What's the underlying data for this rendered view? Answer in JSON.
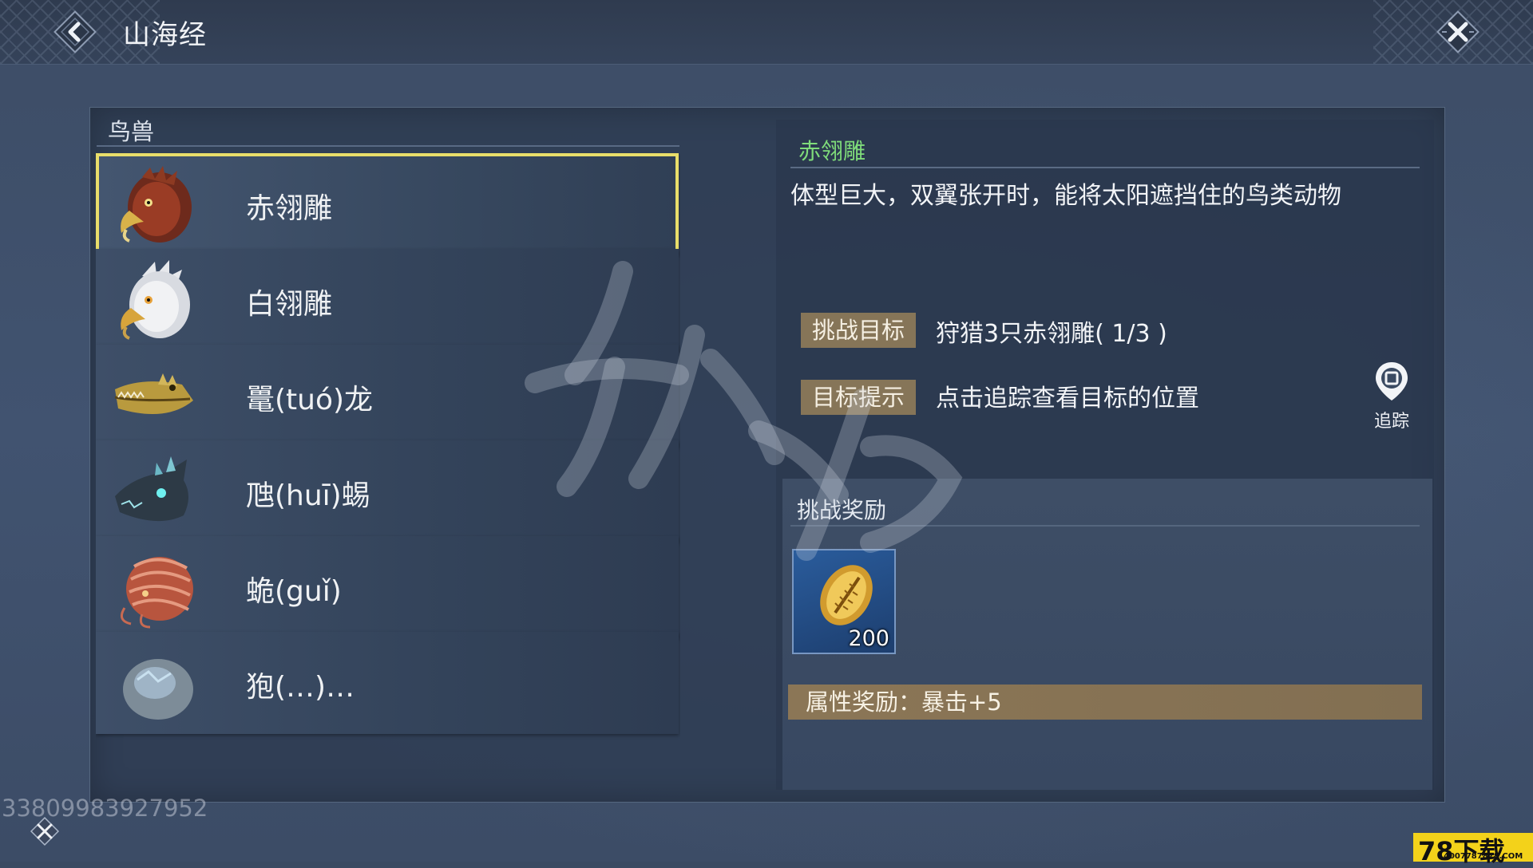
{
  "header": {
    "title": "山海经",
    "back_icon": "chevron-left-icon",
    "close_icon": "close-icon"
  },
  "category": {
    "title": "鸟兽"
  },
  "creatures": [
    {
      "name": "赤翎雕",
      "portrait": "red-eagle-portrait",
      "selected": true
    },
    {
      "name": "白翎雕",
      "portrait": "white-eagle-portrait",
      "selected": false
    },
    {
      "name": "鼍(tuó)龙",
      "portrait": "crocodile-portrait",
      "selected": false
    },
    {
      "name": "虺(huī)蜴",
      "portrait": "lizard-portrait",
      "selected": false
    },
    {
      "name": "蛫(guǐ)",
      "portrait": "sea-creature-portrait",
      "selected": false
    },
    {
      "name": "狍(…)…",
      "portrait": "stone-beast-portrait",
      "selected": false
    }
  ],
  "detail": {
    "name": "赤翎雕",
    "description": "体型巨大，双翼张开时，能将太阳遮挡住的鸟类动物",
    "challenge_label": "挑战目标",
    "challenge_value": "狩猎3只赤翎雕( 1/3 )",
    "hint_label": "目标提示",
    "hint_value": "点击追踪查看目标的位置",
    "track_label": "追踪",
    "reward_title": "挑战奖励",
    "reward_item": {
      "icon": "gold-shell-icon",
      "count": "200"
    },
    "attribute_reward": "属性奖励：暴击+5"
  },
  "overlay": {
    "user_id": "33809983927952",
    "brand": "78下载",
    "brand_sub": "4007787878.COM"
  },
  "colors": {
    "selected_outline": "#e9de6a",
    "detail_name": "#7fdc7a",
    "tag_bg": "#867558",
    "reward_slot": "#2a5c9c"
  }
}
